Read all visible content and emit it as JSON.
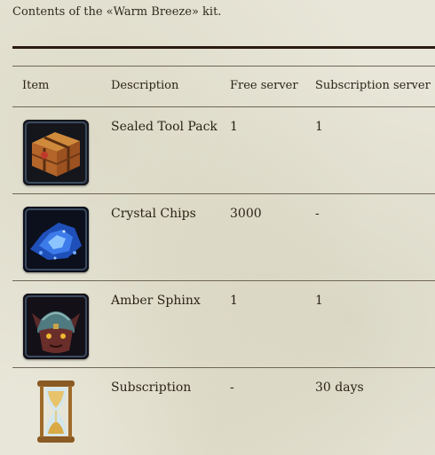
{
  "intro_text": "Contents of the «Warm Breeze» kit.",
  "table": {
    "headers": {
      "item": "Item",
      "description": "Description",
      "free": "Free server",
      "subscription": "Subscription server"
    },
    "rows": [
      {
        "icon": "wooden-crate-icon",
        "description": "Sealed Tool Pack",
        "free": "1",
        "subscription": "1"
      },
      {
        "icon": "blue-crystal-chips-icon",
        "description": "Crystal Chips",
        "free": "3000",
        "subscription": "-"
      },
      {
        "icon": "armored-sphinx-icon",
        "description": "Amber Sphinx",
        "free": "1",
        "subscription": "1"
      },
      {
        "icon": "hourglass-icon",
        "description": "Subscription",
        "free": "-",
        "subscription": "30 days"
      }
    ]
  }
}
